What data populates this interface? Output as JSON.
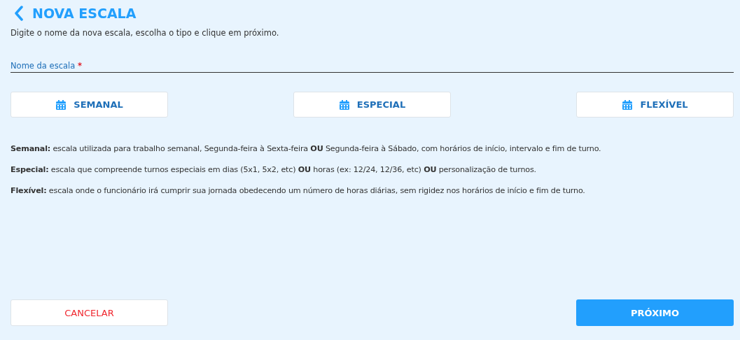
{
  "header": {
    "title": "NOVA ESCALA",
    "subtitle": "Digite o nome da nova escala, escolha o tipo e clique em próximo."
  },
  "name_field": {
    "label": "Nome da escala",
    "required_mark": "*"
  },
  "types": [
    {
      "label": "SEMANAL",
      "selected": false
    },
    {
      "label": "ESPECIAL",
      "selected": false
    },
    {
      "label": "FLEXÍVEL",
      "selected": false
    }
  ],
  "descriptions": [
    "**Semanal:** escala utilizada para trabalho semanal, Segunda-feira à Sexta-feira **OU** Segunda-feira à Sábado, com horários de início, intervalo e fim de turno.",
    "**Especial:** escala que compreende turnos especiais em dias (5x1, 5x2, etc) **OU** horas (ex: 12/24, 12/36, etc) **OU** personalização de turnos.",
    "**Flexível:** escala onde o funcionário irá cumprir sua jornada obedecendo um número de horas diárias, sem rigidez nos horários de início e fim de turno."
  ],
  "footer": {
    "cancel": "CANCELAR",
    "next": "PRÓXIMO"
  }
}
